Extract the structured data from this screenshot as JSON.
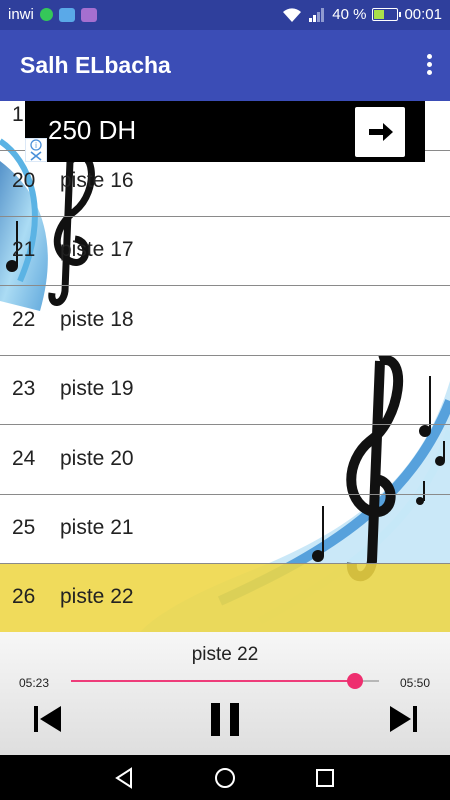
{
  "status_bar": {
    "carrier": "inwi",
    "battery_level": 0.4,
    "battery_text": "40 %",
    "time": "00:01",
    "icons": [
      "whatsapp-icon",
      "message-icon",
      "gallery-icon",
      "wifi-icon",
      "signal-icon",
      "battery-icon"
    ]
  },
  "app_bar": {
    "title": "Salh ELbacha",
    "menu_icon": "overflow-menu-icon"
  },
  "ad": {
    "text": "250 DH",
    "button_icon": "arrow-right-icon",
    "info_icon": "info-icon",
    "close_icon": "close-icon"
  },
  "tracks": [
    {
      "number": "1",
      "title": ""
    },
    {
      "number": "20",
      "title": "piste 16"
    },
    {
      "number": "21",
      "title": "piste 17"
    },
    {
      "number": "22",
      "title": "piste 18"
    },
    {
      "number": "23",
      "title": "piste 19"
    },
    {
      "number": "24",
      "title": "piste 20"
    },
    {
      "number": "25",
      "title": "piste 21"
    },
    {
      "number": "26",
      "title": "piste 22"
    }
  ],
  "selected_index": 7,
  "player": {
    "now_playing": "piste 22",
    "current_time": "05:23",
    "duration": "05:50",
    "progress": 0.923,
    "controls": [
      "skip-previous-icon",
      "pause-icon",
      "skip-next-icon"
    ]
  },
  "nav_bar": {
    "buttons": [
      "back-icon",
      "home-icon",
      "recents-icon"
    ]
  },
  "colors": {
    "status_bar": "#2f3f9c",
    "app_bar": "#3b4db6",
    "accent": "#ee2f6f",
    "selected_row": "#eed644"
  }
}
